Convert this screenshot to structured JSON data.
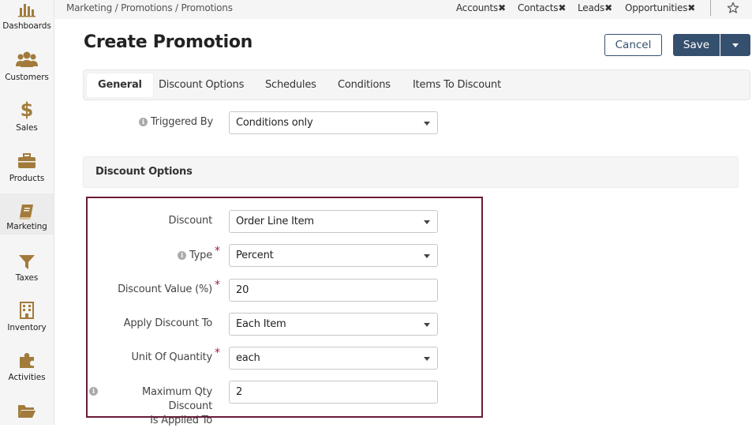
{
  "sidebar": {
    "items": [
      {
        "label": "Dashboards",
        "icon": "bar-chart-icon"
      },
      {
        "label": "Customers",
        "icon": "users-icon"
      },
      {
        "label": "Sales",
        "icon": "dollar-icon"
      },
      {
        "label": "Products",
        "icon": "briefcase-icon"
      },
      {
        "label": "Marketing",
        "icon": "book-icon"
      },
      {
        "label": "Taxes",
        "icon": "funnel-icon"
      },
      {
        "label": "Inventory",
        "icon": "building-icon"
      },
      {
        "label": "Activities",
        "icon": "puzzle-icon"
      },
      {
        "label": "",
        "icon": "folder-icon"
      }
    ],
    "active": "Marketing",
    "icon_color": "#a27b3c"
  },
  "topbar": {
    "breadcrumb": "Marketing / Promotions / Promotions",
    "tabs": [
      "Accounts",
      "Contacts",
      "Leads",
      "Opportunities"
    ]
  },
  "page": {
    "title": "Create Promotion",
    "cancel_label": "Cancel",
    "save_label": "Save"
  },
  "tabs": [
    "General",
    "Discount Options",
    "Schedules",
    "Conditions",
    "Items To Discount"
  ],
  "general": {
    "triggered_by_label": "Triggered By",
    "triggered_by_value": "Conditions only"
  },
  "discount_options": {
    "section_title": "Discount Options",
    "discount_label": "Discount",
    "discount_value": "Order Line Item",
    "type_label": "Type",
    "type_value": "Percent",
    "discount_pct_label": "Discount Value (%)",
    "discount_pct_value": "20",
    "apply_label": "Apply Discount To",
    "apply_value": "Each Item",
    "uoq_label": "Unit Of Quantity",
    "uoq_value": "each",
    "max_qty_label_line1": "Maximum Qty Discount",
    "max_qty_label_line2": "Is Applied To",
    "max_qty_value": "2"
  },
  "colors": {
    "primary": "#35506e",
    "accent_icon": "#a27b3c",
    "required": "#a0203a",
    "highlight_border": "#6b1a3a"
  }
}
